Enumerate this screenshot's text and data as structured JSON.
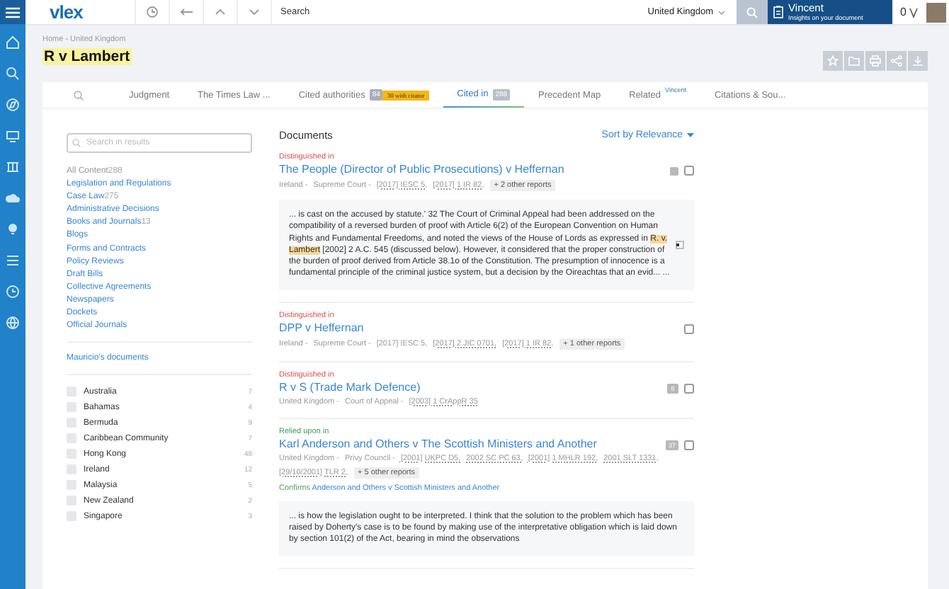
{
  "topbar": {
    "logo": "vlex",
    "search": {
      "placeholder": "Search"
    },
    "jurisdiction": "United Kingdom",
    "vincent": {
      "title": "Vincent",
      "subtitle": "Insights on your document"
    },
    "credits": "0"
  },
  "breadcrumb": "Home - United Kingdom",
  "title": "R v Lambert",
  "tabs": [
    {
      "label": "Judgment",
      "selected": false
    },
    {
      "label": "The Times Law ...",
      "selected": false
    },
    {
      "label": "Cited authorities",
      "count": "84",
      "flag": "30 with citator",
      "selected": false
    },
    {
      "label": "Cited in",
      "count": "288",
      "selected": true
    },
    {
      "label": "Precedent Map",
      "selected": false
    },
    {
      "label": "Related",
      "sup": "Vincent",
      "selected": false
    },
    {
      "label": "Citations & Sou...",
      "selected": false
    }
  ],
  "filters": {
    "search": {
      "placeholder": "Search in results"
    },
    "content_types": [
      {
        "label": "All Content",
        "count": "288",
        "selected": true
      },
      {
        "label": "Legislation and Regulations",
        "selected": false
      },
      {
        "label": "Case Law",
        "count": "275",
        "selected": false
      },
      {
        "label": "Administrative Decisions",
        "selected": false
      },
      {
        "label": "Books and Journals",
        "count": "13",
        "selected": false
      },
      {
        "label": "Blogs",
        "selected": false
      },
      {
        "label": "Forms and Contracts",
        "selected": false
      },
      {
        "label": "Policy Reviews",
        "selected": false
      },
      {
        "label": "Draft Bills",
        "selected": false
      },
      {
        "label": "Collective Agreements",
        "selected": false
      },
      {
        "label": "Newspapers",
        "selected": false
      },
      {
        "label": "Dockets",
        "selected": false
      },
      {
        "label": "Official Journals",
        "selected": false
      }
    ],
    "my_documents": "Mauricio's documents",
    "jurisdictions": [
      {
        "name": "Australia",
        "count": "7",
        "checked": false
      },
      {
        "name": "Bahamas",
        "count": "4",
        "checked": false
      },
      {
        "name": "Bermuda",
        "count": "9",
        "checked": false
      },
      {
        "name": "Caribbean Community",
        "count": "7",
        "checked": false
      },
      {
        "name": "Hong Kong",
        "count": "48",
        "checked": false
      },
      {
        "name": "Ireland",
        "count": "12",
        "checked": false
      },
      {
        "name": "Malaysia",
        "count": "5",
        "checked": false
      },
      {
        "name": "New Zealand",
        "count": "2",
        "checked": false
      },
      {
        "name": "Singapore",
        "count": "3",
        "checked": false
      }
    ]
  },
  "documents": {
    "heading": "Documents",
    "sort": "Sort by Relevance",
    "items": [
      {
        "relation": {
          "label": "Distinguished in",
          "color": "#d9534f"
        },
        "title": "The People (Director of Public Prosecutions) v Heffernan",
        "flagged": true,
        "checked": false,
        "meta": [
          "Ireland -",
          "Supreme Court -"
        ],
        "citations": [
          "[2017] IESC 5,",
          "[2017] 1 IR 82,"
        ],
        "more": "+ 2 other reports",
        "snippet": "... is cast on the accused by statute.' 32 The Court of Criminal Appeal had been addressed on the compatibility of a reversed burden of proof with Article 6(2) of the European Convention on Human Rights and Fundamental Freedoms, and noted the views of the House of Lords as expressed in **R. v. Lambert** [2002] 2 A.C. 545 (discussed below). However, it considered that the proper construction of the burden of proof derived from Article 38.1o of the Constitution. The presumption of innocence is a fundamental principle of the criminal justice system, but a decision by the Oireachtas that an evid... ..."
      },
      {
        "relation": {
          "label": "Distinguished in",
          "color": "#d9534f"
        },
        "title": "DPP v Heffernan",
        "checked": false,
        "meta": [
          "Ireland -",
          "Supreme Court -",
          "[2017] IESC 5,"
        ],
        "citations": [
          "[2017] 2 JIC 0701,",
          "[2017] 1 IR 82,"
        ],
        "more": "+ 1 other reports"
      },
      {
        "relation": {
          "label": "Distinguished in",
          "color": "#d9534f"
        },
        "title": "R v S (Trade Mark Defence)",
        "badge": "6",
        "checked": false,
        "meta": [
          "United Kingdom -",
          "Court of Appeal -"
        ],
        "citations": [
          "[2003] 1 CrAppR 35"
        ]
      },
      {
        "relation": {
          "label": "Relied upon in",
          "color": "#3c9a5f"
        },
        "title": "Karl Anderson and Others v The Scottish Ministers and Another",
        "badge": "37",
        "checked": false,
        "meta": [
          "United Kingdom -",
          "Privy Council -"
        ],
        "citations": [
          "[2001] UKPC D5,",
          "2002 SC PC 63,",
          "[2001] 1 MHLR 192,",
          "2001 SLT 1331,",
          "[29/10/2001] TLR 2,"
        ],
        "more": "+ 5 other reports",
        "note": {
          "label": "Confirms",
          "link": "Anderson and Others v Scottish Ministers and Another"
        },
        "snippet": "... is how the legislation ought to be interpreted. I think that the solution to the problem which has been raised by Doherty's case is to be found by making use of the interpretative obligation which is laid down by section 101(2) of the Act, bearing in mind the observations"
      }
    ]
  }
}
